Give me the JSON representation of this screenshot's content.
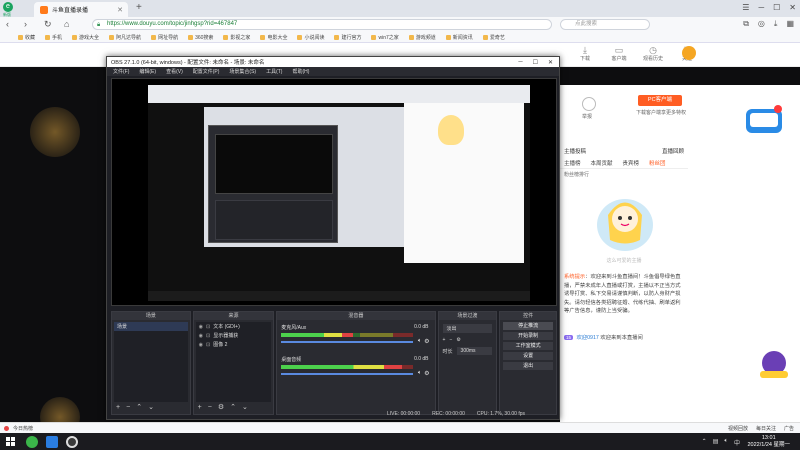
{
  "browser": {
    "brand_label": "新版",
    "tab_title": "斗鱼直播录播",
    "url": "https://www.douyu.com/topic/jinhgsp?rid=467847",
    "search_placeholder": "点此搜索"
  },
  "bookmarks": [
    "收藏",
    "手机",
    "游戏大全",
    "阿凡达导航",
    "网址导航",
    "360搜索",
    "影视之家",
    "电影大全",
    "小说阅读",
    "建行官方",
    "win7之家",
    "游戏频道",
    "新闻资讯",
    "爱奇艺"
  ],
  "douyu_header": {
    "icons": [
      {
        "label": "下载",
        "icon": "download-icon"
      },
      {
        "label": "客户端",
        "icon": "client-icon"
      },
      {
        "label": "观看历史",
        "icon": "history-icon"
      },
      {
        "label": "关注",
        "icon": "follow-icon"
      }
    ]
  },
  "anchor": {
    "pc_button": "PC客户端",
    "client_dl": "下载客户端享更多特权",
    "report_label": "举报"
  },
  "side": {
    "tab_hint_left": "主播投稿",
    "tab_hint_right": "直播回顾",
    "tabs": [
      "主播榜",
      "本周贡献",
      "贵宾榜",
      "粉丝团"
    ],
    "tip": "粉丝榜排行",
    "mascot_caption": "这么可爱的主播"
  },
  "chat": {
    "notice_label": "系统提示",
    "notice_text": "：欢迎来到斗鱼直播间！斗鱼倡导绿色直播，严禁未成年人直播或打赏，主播以不正当方式诱导打赏、私下交易请谨慎判断，以防人身财产损失。请勿轻信各类招聘征婚、代练代抽、刷单返利等广告信息，谨防上当受骗。",
    "welcome_badge": "15",
    "welcome_user": "欢迎0917",
    "welcome_text": "欢迎来到本直播间"
  },
  "obs": {
    "title": "OBS 27.1.0 (64-bit, windows) - 配置文件: 未命名 - 场景: 未命名",
    "menu": [
      "文件(F)",
      "编辑(E)",
      "查看(V)",
      "配置文件(P)",
      "场景集合(S)",
      "工具(T)",
      "帮助(H)"
    ],
    "docks": {
      "scenes_title": "场景",
      "sources_title": "来源",
      "mixer_title": "混音器",
      "transitions_title": "场景过渡",
      "controls_title": "控件"
    },
    "scenes": [
      "场景"
    ],
    "sources": [
      "文本 (GDI+)",
      "显示器捕获",
      "图像 2"
    ],
    "mixer": [
      {
        "name": "麦克风/Aux",
        "db": "0.0 dB",
        "level": 0.55
      },
      {
        "name": "桌面音频",
        "db": "0.0 dB",
        "level": 0.92
      }
    ],
    "transition": {
      "mode": "淡出",
      "duration_label": "时长",
      "duration": "300ms"
    },
    "controls": [
      "停止推流",
      "开始录制",
      "工作室模式",
      "设置",
      "退出"
    ],
    "status": {
      "live": "LIVE: 00:00:00",
      "rec": "REC: 00:00:00",
      "cpu": "CPU: 1.7%, 30.00 fps"
    }
  },
  "page_footer": {
    "left": "今日热榜",
    "right": [
      "视频回放",
      "每日关注",
      "广告"
    ]
  },
  "taskbar": {
    "clock_time": "13:01",
    "clock_date": "2022/1/24 星期一"
  },
  "colors": {
    "douyu_orange": "#ff5d23",
    "obs_bg": "#1e1f25",
    "meter_green": "#4cd14c"
  }
}
